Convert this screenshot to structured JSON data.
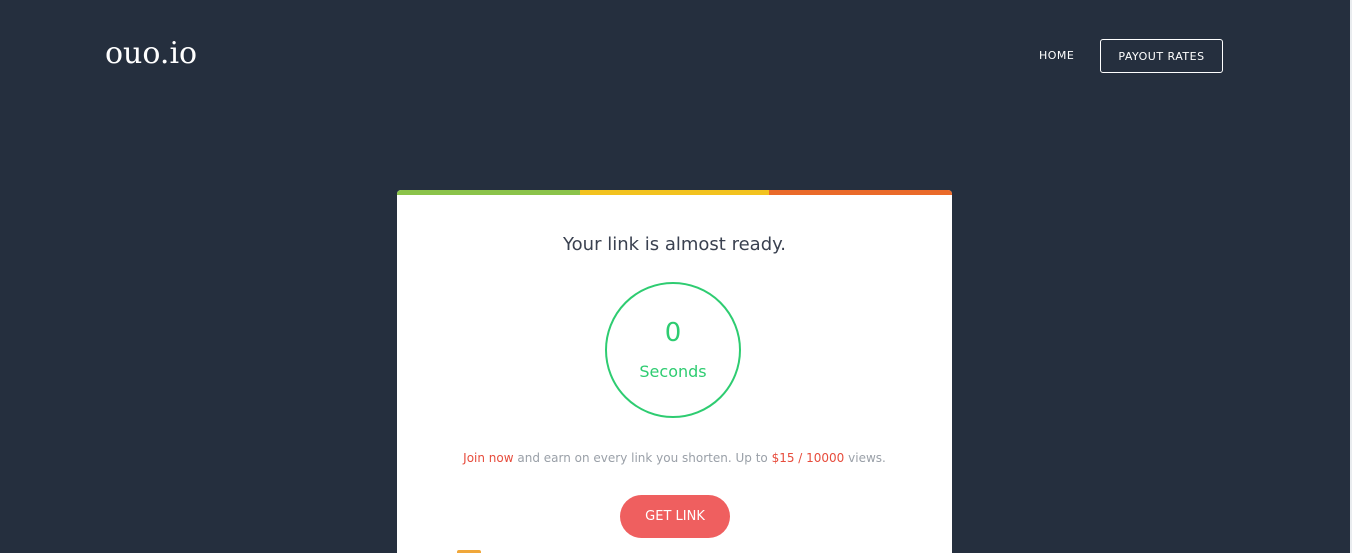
{
  "header": {
    "logo": "ouo.io",
    "nav": {
      "home": "HOME",
      "payout_rates": "PAYOUT RATES"
    }
  },
  "card": {
    "stripe_colors": [
      "#8bc34a",
      "#f2c21f",
      "#ea6a2a"
    ],
    "headline": "Your link is almost ready.",
    "timer": {
      "count": "0",
      "unit": "Seconds"
    },
    "promo": {
      "join": "Join now",
      "text_before_rate": " and earn on every link you shorten. Up to ",
      "rate": "$15 / 10000",
      "text_after_rate": " views."
    },
    "get_link": "GET LINK"
  },
  "colors": {
    "background": "#252f3e",
    "accent_green": "#2ecc71",
    "accent_red": "#ef5f5f"
  }
}
